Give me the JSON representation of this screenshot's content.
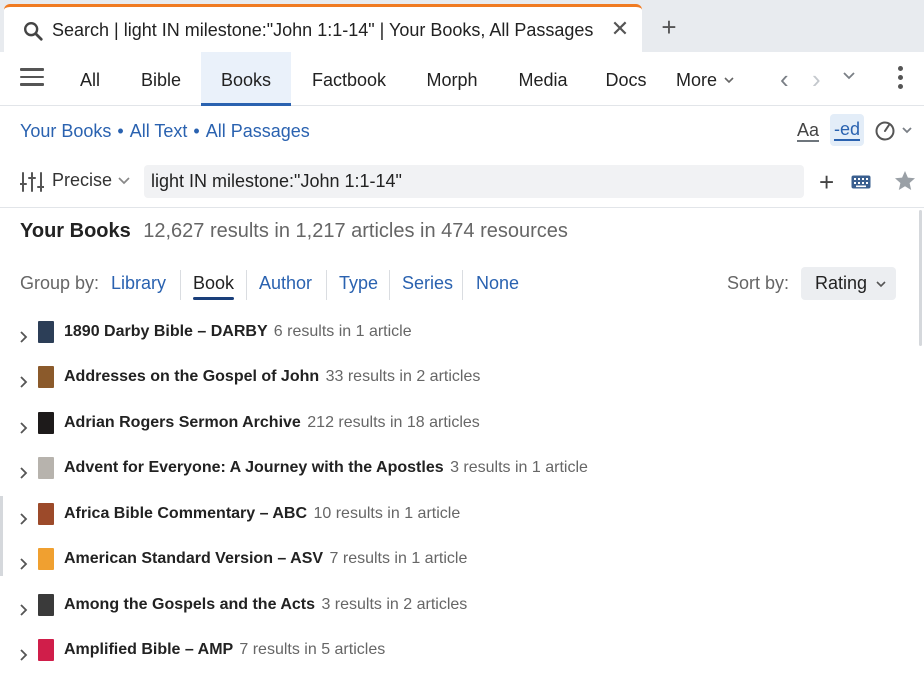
{
  "tab": {
    "title": "Search | light IN milestone:\"John 1:1-14\" | Your Books, All Passages",
    "close_icon": "close-icon",
    "new_tab_icon": "plus-icon"
  },
  "nav": {
    "tabs": [
      "All",
      "Bible",
      "Books",
      "Factbook",
      "Morph",
      "Media",
      "Docs"
    ],
    "active": "Books",
    "more_label": "More"
  },
  "scope": {
    "items": [
      "Your Books",
      "All Text",
      "All Passages"
    ],
    "separator": "•"
  },
  "tools": {
    "font_label": "Aa",
    "ed_label": "-ed"
  },
  "search": {
    "mode": "Precise",
    "query": "light IN milestone:\"John 1:1-14\""
  },
  "results": {
    "heading": "Your Books",
    "summary": "12,627 results in 1,217 articles in 474 resources"
  },
  "group_by": {
    "label": "Group by:",
    "options": [
      "Library",
      "Book",
      "Author",
      "Type",
      "Series",
      "None"
    ],
    "selected": "Book"
  },
  "sort_by": {
    "label": "Sort by:",
    "value": "Rating"
  },
  "books": [
    {
      "title": "1890 Darby Bible – DARBY",
      "count": "6 results in 1 article",
      "cover_color": "#2c3e57"
    },
    {
      "title": "Addresses on the Gospel of John",
      "count": "33 results in 2 articles",
      "cover_color": "#8b5a2b"
    },
    {
      "title": "Adrian Rogers Sermon Archive",
      "count": "212 results in 18 articles",
      "cover_color": "#1d1a1a"
    },
    {
      "title": "Advent for Everyone: A Journey with the Apostles",
      "count": "3 results in 1 article",
      "cover_color": "#b7b3ad"
    },
    {
      "title": "Africa Bible Commentary – ABC",
      "count": "10 results in 1 article",
      "cover_color": "#9c4a2a"
    },
    {
      "title": "American Standard Version – ASV",
      "count": "7 results in 1 article",
      "cover_color": "#f0a030"
    },
    {
      "title": "Among the Gospels and the Acts",
      "count": "3 results in 2 articles",
      "cover_color": "#3a3a3a"
    },
    {
      "title": "Amplified Bible – AMP",
      "count": "7 results in 5 articles",
      "cover_color": "#d01e4a"
    }
  ]
}
